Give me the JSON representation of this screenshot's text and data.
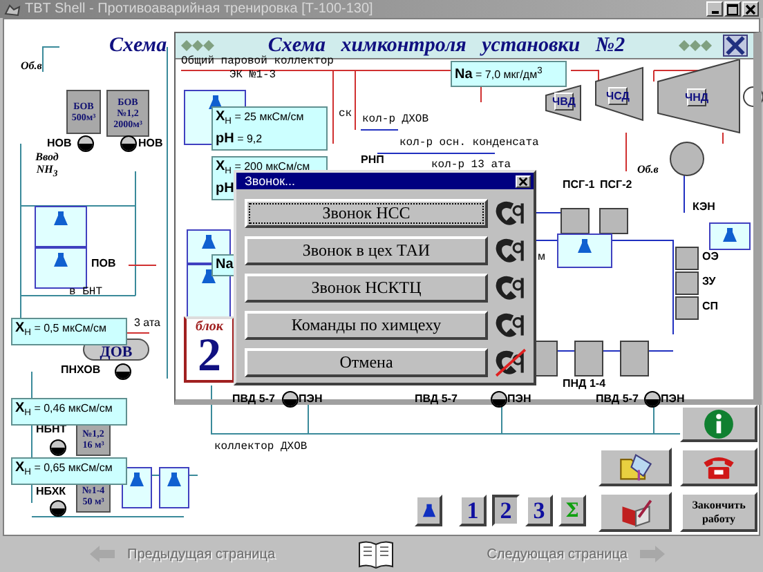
{
  "window": {
    "title": "TBT Shell - Противоаварийная тренировка [Т-100-130]"
  },
  "scheme": {
    "title": "Схема",
    "tanks": [
      {
        "lines": [
          "БОВ",
          "500м³"
        ]
      },
      {
        "lines": [
          "БОВ",
          "№1,2",
          "2000м³"
        ]
      },
      {
        "lines": [
          "№1,2",
          "16 м³"
        ]
      },
      {
        "lines": [
          "№1-4",
          "50 м³"
        ]
      },
      {
        "lines": [
          "ДОВ"
        ]
      }
    ],
    "pumps": [
      {
        "label": "НОВ"
      },
      {
        "label": "НОВ"
      },
      {
        "label": "ПНХОВ"
      },
      {
        "label": "НБНТ"
      },
      {
        "label": "НБХК"
      },
      {
        "label": "ПЭН"
      },
      {
        "label": "ПЭН"
      },
      {
        "label": "ПЭН"
      }
    ],
    "labels": [
      "Об.в",
      "Ввод NH$_{3}$",
      "ПОВ",
      "в БНТ",
      "3 ата",
      "ПВД 5-7",
      "ПВД 5-7",
      "ПВД 5-7",
      "коллектор ДХОВ"
    ],
    "readings": [
      {
        "lines": [
          "**X**$_{H}$ = 25 мкСм/см",
          "**pH** = 9,2"
        ]
      },
      {
        "lines": [
          "**X**$_{H}$ = 200 мкСм/см",
          "**pH**"
        ]
      },
      {
        "lines": [
          "**X**$_{H}$ = 0,5 мкСм/см"
        ]
      },
      {
        "lines": [
          "**X**$_{H}$ = 0,46 мкСм/см"
        ]
      },
      {
        "lines": [
          "**X**$_{H}$ = 0,65 мкСм/см"
        ]
      },
      {
        "lines": [
          "**Na** = 7,0 мкг/дм$^{3}$"
        ]
      },
      {
        "lines": [
          "**Na**"
        ]
      }
    ]
  },
  "inner_window": {
    "title": "Схема   химконтроля   установки   №2",
    "labels": [
      "Общий паровой коллектор",
      "ЭК №1-3",
      "ск",
      "кол-р ДХОВ",
      "кол-р осн. конденсата",
      "РНП",
      "кол-р 13 ата",
      "ЧВД",
      "ЧСД",
      "ЧНД",
      "Об.в",
      "ПСГ-1",
      "ПСГ-2",
      "КЭН",
      "м",
      "ОЭ",
      "ЗУ",
      "СП",
      "ПНД 1-4"
    ],
    "block": {
      "label": "блок",
      "number": "2"
    }
  },
  "dialog": {
    "title": "Звонок...",
    "options": [
      {
        "label": "Звонок НСС",
        "focused": true,
        "crossed": false
      },
      {
        "label": "Звонок в цех ТАИ",
        "focused": false,
        "crossed": false
      },
      {
        "label": "Звонок НСКТЦ",
        "focused": false,
        "crossed": false
      },
      {
        "label": "Команды по химцеху",
        "focused": false,
        "crossed": false
      },
      {
        "label": "Отмена",
        "focused": false,
        "crossed": true
      }
    ]
  },
  "pages": [
    {
      "kind": "flask",
      "selected": false
    },
    {
      "kind": "number",
      "label": "1",
      "selected": false
    },
    {
      "kind": "number",
      "label": "2",
      "selected": true
    },
    {
      "kind": "number",
      "label": "3",
      "selected": false
    },
    {
      "kind": "sum",
      "label": "Σ",
      "selected": false
    }
  ],
  "actions": [
    {
      "kind": "info"
    },
    {
      "kind": "phone"
    },
    {
      "kind": "folder"
    },
    {
      "kind": "journal"
    },
    {
      "kind": "text",
      "label": "Закончить работу"
    }
  ],
  "footer": {
    "prev": {
      "label": "Предыдущая страница",
      "disabled": true
    },
    "next": {
      "label": "Следующая страница",
      "disabled": true
    }
  }
}
